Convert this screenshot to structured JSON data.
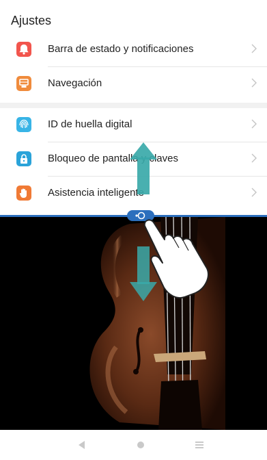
{
  "header": {
    "title": "Ajustes"
  },
  "settings": {
    "items": [
      {
        "label": "Barra de estado y notificaciones",
        "icon": "notification-icon",
        "color": "#f2554d"
      },
      {
        "label": "Navegación",
        "icon": "navigation-icon",
        "color": "#f08b3c"
      },
      {
        "label": "ID de huella digital",
        "icon": "fingerprint-icon",
        "color": "#38b4e6"
      },
      {
        "label": "Bloqueo de pantalla y claves",
        "icon": "lock-icon",
        "color": "#2aa3d9"
      },
      {
        "label": "Asistencia inteligente",
        "icon": "hand-icon",
        "color": "#f07a35"
      }
    ]
  },
  "split_handle": {
    "icon": "split-handle-icon",
    "color": "#2c6fbd"
  },
  "media": {
    "subject": "violin-image"
  },
  "gesture": {
    "icons": [
      "swipe-up-arrow-icon",
      "swipe-down-arrow-icon",
      "pointing-hand-icon"
    ],
    "arrow_color": "#3aa9a9"
  },
  "navbar": {
    "buttons": [
      "back-icon",
      "home-icon",
      "recents-icon"
    ]
  }
}
